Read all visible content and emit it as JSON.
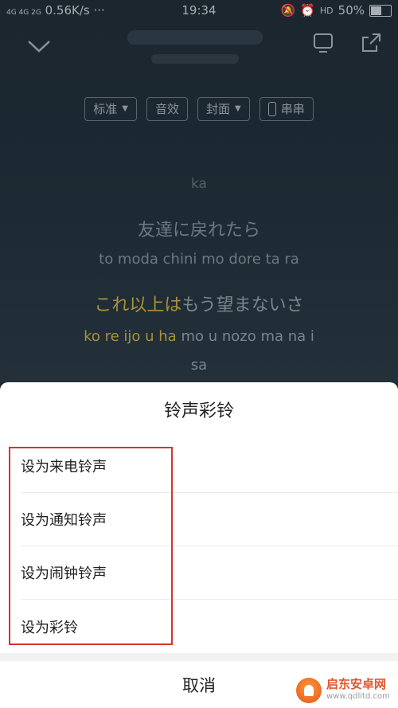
{
  "status_bar": {
    "signal": "4G 4G 2G",
    "network_speed": "0.56K/s",
    "more": "···",
    "time": "19:34",
    "hd_label": "HD",
    "battery": "50%"
  },
  "player": {
    "controls": [
      {
        "label": "标准",
        "has_dropdown": true
      },
      {
        "label": "音效",
        "has_dropdown": false
      },
      {
        "label": "封面",
        "has_dropdown": true
      },
      {
        "label": "串串",
        "has_toggle": true
      }
    ],
    "lyrics": {
      "prev_fragment": "ka",
      "line1": "友達に戻れたら",
      "line1_romaji": "to moda chini mo dore ta ra",
      "line2_sung": "これ以上は",
      "line2_rest": "もう望まないさ",
      "line2_romaji_sung": "ko re ijo u ha",
      "line2_romaji_rest": "mo u nozo ma na i",
      "line2_romaji_wrap": "sa"
    },
    "highlight_color": "#a9923a"
  },
  "sheet": {
    "title": "铃声彩铃",
    "options": [
      {
        "label": "设为来电铃声"
      },
      {
        "label": "设为通知铃声"
      },
      {
        "label": "设为闹钟铃声"
      },
      {
        "label": "设为彩铃"
      }
    ],
    "cancel_label": "取消",
    "annotation_color": "#d6332f"
  },
  "watermark": {
    "name": "启东安卓网",
    "url": "www.qdlitd.com"
  }
}
